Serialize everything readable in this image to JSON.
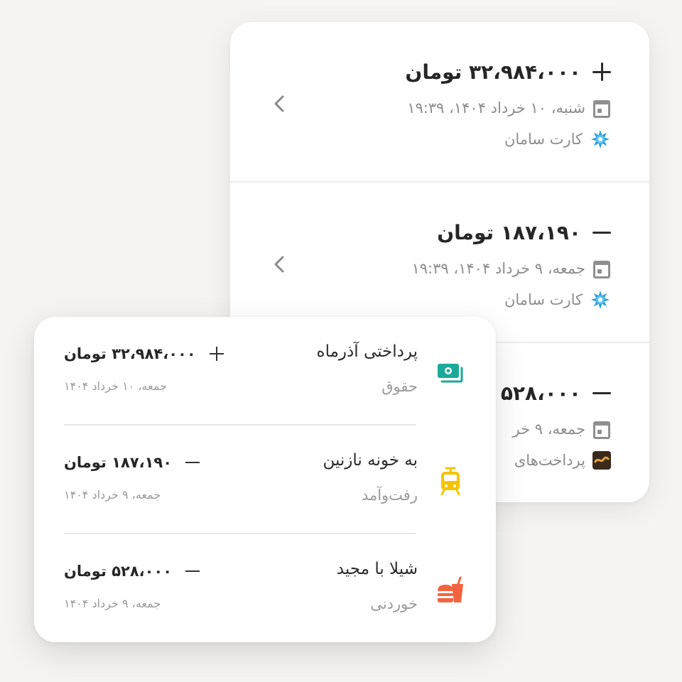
{
  "colors": {
    "background": "#f5f4f2",
    "card": "#ffffff",
    "text_primary": "#262626",
    "text_secondary": "#9a9a9a",
    "salary_icon": "#1ba99a",
    "transport_icon": "#f5c400",
    "food_icon": "#f26440",
    "saman_blue": "#2a9fd8"
  },
  "back_card": {
    "transactions": [
      {
        "sign": "plus",
        "amount": "۳۲،۹۸۴،۰۰۰ تومان",
        "datetime": "شنبه، ۱۰ خرداد ۱۴۰۴، ۱۹:۳۹",
        "account": "کارت سامان",
        "account_icon": "saman-bank-icon"
      },
      {
        "sign": "minus",
        "amount": "۱۸۷،۱۹۰ تومان",
        "datetime": "جمعه، ۹ خرداد ۱۴۰۴، ۱۹:۳۹",
        "account": "کارت سامان",
        "account_icon": "saman-bank-icon"
      },
      {
        "sign": "minus",
        "amount": "۵۲۸،۰۰۰",
        "datetime": "جمعه، ۹ خر",
        "account": "پرداخت‌های",
        "account_icon": "finance-icon"
      }
    ]
  },
  "front_card": {
    "transactions": [
      {
        "title": "پرداختی آذرماه",
        "category": "حقوق",
        "category_icon": "salary-cash-icon",
        "sign": "plus",
        "amount": "۳۲،۹۸۴،۰۰۰ تومان",
        "date": "جمعه، ۱۰ خرداد ۱۴۰۴"
      },
      {
        "title": "به خونه نازنین",
        "category": "رفت‌وآمد",
        "category_icon": "transport-train-icon",
        "sign": "minus",
        "amount": "۱۸۷،۱۹۰ تومان",
        "date": "جمعه، ۹ خرداد ۱۴۰۴"
      },
      {
        "title": "شیلا با مجید",
        "category": "خوردنی",
        "category_icon": "food-burger-icon",
        "sign": "minus",
        "amount": "۵۲۸،۰۰۰ تومان",
        "date": "جمعه، ۹ خرداد ۱۴۰۴"
      }
    ]
  }
}
